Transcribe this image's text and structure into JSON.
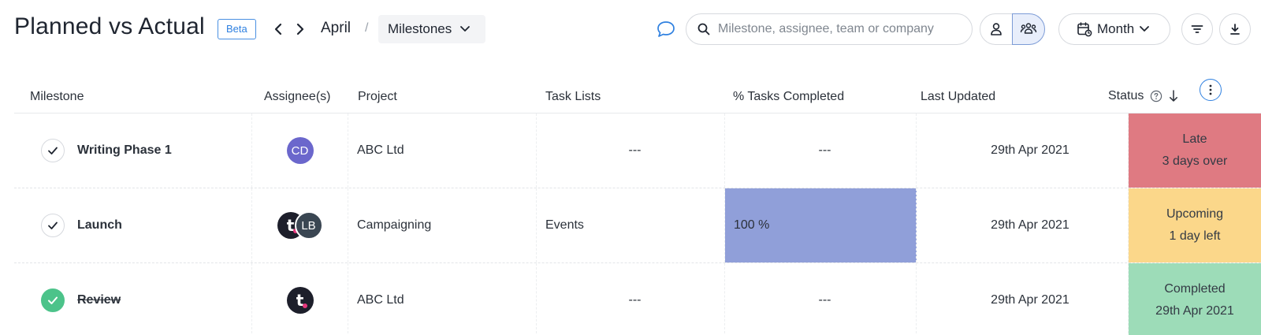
{
  "header": {
    "title": "Planned vs Actual",
    "beta_label": "Beta",
    "breadcrumb_month": "April",
    "breadcrumb_separator": "/",
    "view_select": "Milestones",
    "search_placeholder": "Milestone, assignee, team or company",
    "period_label": "Month"
  },
  "table": {
    "columns": {
      "milestone": "Milestone",
      "assignees": "Assignee(s)",
      "project": "Project",
      "task_lists": "Task Lists",
      "pct_completed": "% Tasks Completed",
      "last_updated": "Last Updated",
      "status": "Status"
    },
    "rows": [
      {
        "milestone": "Writing Phase 1",
        "done": false,
        "assignee_initials": [
          "CD"
        ],
        "project": "ABC Ltd",
        "task_lists": "---",
        "pct_completed": "---",
        "last_updated": "29th Apr 2021",
        "status_title": "Late",
        "status_detail": "3 days over",
        "status_color": "#df7a82"
      },
      {
        "milestone": "Launch",
        "done": false,
        "assignee_initials": [
          "t",
          "LB"
        ],
        "project": "Campaigning",
        "task_lists": "Events",
        "pct_completed": "100 %",
        "pct_color": "#909fd9",
        "last_updated": "29th Apr 2021",
        "status_title": "Upcoming",
        "status_detail": "1 day left",
        "status_color": "#fbd78a"
      },
      {
        "milestone": "Review",
        "done": true,
        "assignee_initials": [
          "t"
        ],
        "project": "ABC Ltd",
        "task_lists": "---",
        "pct_completed": "---",
        "last_updated": "29th Apr 2021",
        "status_title": "Completed",
        "status_detail": "29th Apr 2021",
        "status_color": "#9ddcb8"
      }
    ]
  },
  "colors": {
    "accent_blue": "#2f80e0",
    "late": "#df7a82",
    "upcoming": "#fbd78a",
    "completed": "#9ddcb8",
    "progress_fill": "#909fd9"
  }
}
